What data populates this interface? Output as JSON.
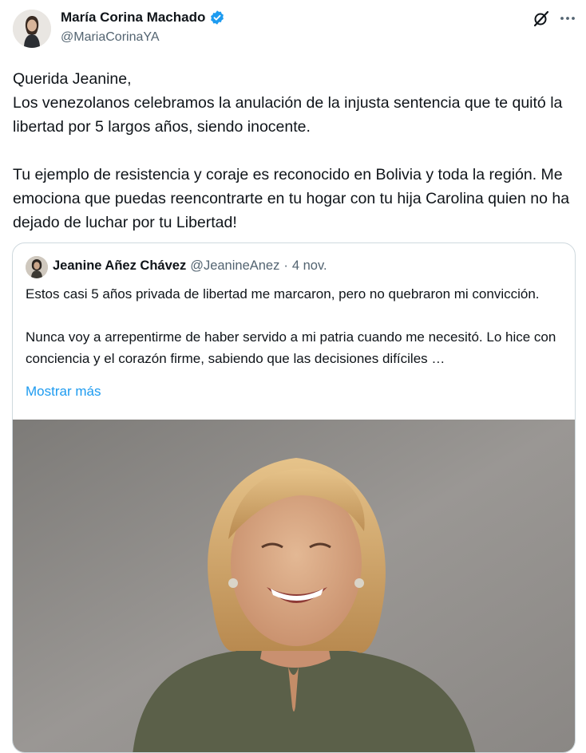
{
  "tweet": {
    "author": {
      "name": "María Corina Machado",
      "handle": "@MariaCorinaYA",
      "verified": true
    },
    "text": "Querida Jeanine,\nLos venezolanos celebramos la anulación de la injusta sentencia que te quitó la libertad por 5 largos años, siendo inocente.\n\nTu ejemplo de resistencia y coraje es reconocido en Bolivia y toda la región. Me emociona que puedas reencontrarte en tu hogar con tu hija Carolina quien no ha dejado de luchar por tu Libertad!",
    "icons": {
      "grok": "grok-icon",
      "more": "more-options-icon"
    }
  },
  "quote": {
    "author": {
      "name": "Jeanine Añez Chávez",
      "handle": "@JeanineAnez",
      "separator": "·",
      "date": "4 nov."
    },
    "text": "Estos casi 5 años privada de libertad me marcaron, pero no quebraron mi convicción.\n\nNunca voy a arrepentirme de haber servido a mi patria cuando me necesitó. Lo hice con conciencia y el corazón firme, sabiendo que las decisiones difíciles …",
    "show_more": "Mostrar más",
    "image": "portrait-photo"
  },
  "colors": {
    "text": "#0f1419",
    "muted": "#536471",
    "link": "#1d9bf0",
    "verified": "#1d9bf0",
    "border": "#cfd9de",
    "photo_background": "#8c8a87",
    "blouse": "#5b6049"
  }
}
